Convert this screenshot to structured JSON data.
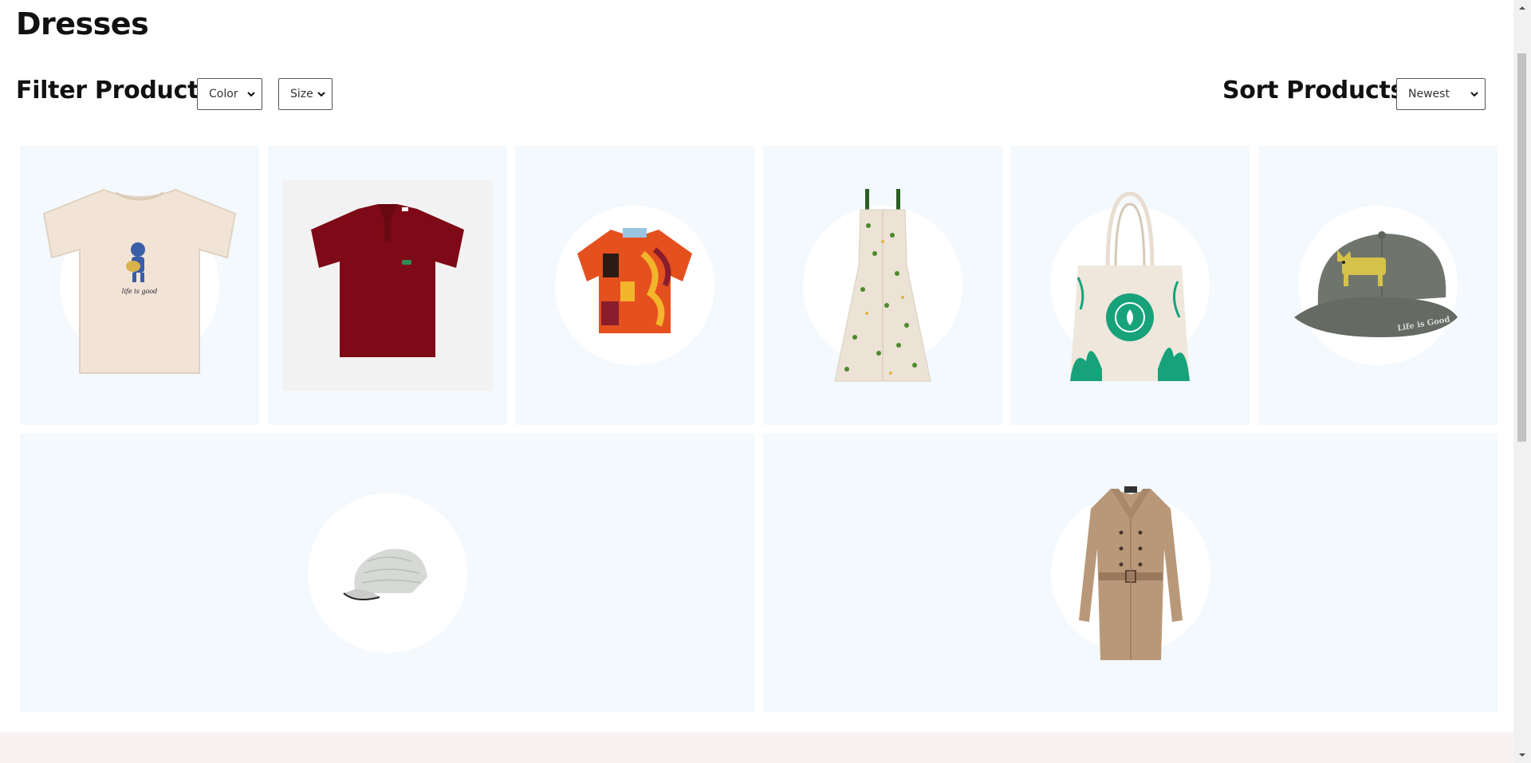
{
  "page": {
    "title": "Dresses"
  },
  "filters": {
    "label": "Filter Products:",
    "color": {
      "selected": "Color"
    },
    "size": {
      "selected": "Size"
    }
  },
  "sort": {
    "label": "Sort Products:",
    "selected": "Newest"
  },
  "colors": {
    "card_bg": "#f3f9fd",
    "footer_bg": "#f8f3f2"
  },
  "products": [
    {
      "icon": "tshirt-icon",
      "product_text": "life is good"
    },
    {
      "icon": "polo-shirt-icon"
    },
    {
      "icon": "hawaiian-shirt-icon"
    },
    {
      "icon": "floral-dress-icon"
    },
    {
      "icon": "tote-bag-icon"
    },
    {
      "icon": "gray-cap-icon",
      "product_text": "Life is Good"
    },
    {
      "icon": "white-cap-icon"
    },
    {
      "icon": "trench-coat-icon"
    }
  ]
}
